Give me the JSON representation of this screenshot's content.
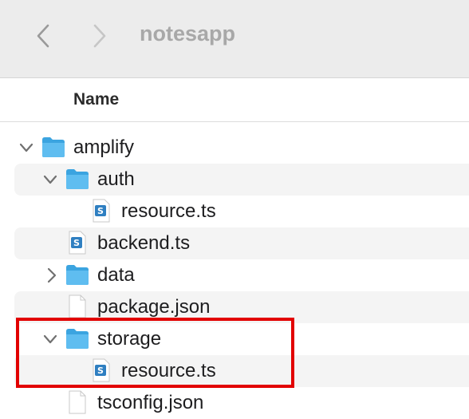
{
  "window": {
    "title": "notesapp"
  },
  "columns": {
    "name": "Name"
  },
  "rows": [
    {
      "label": "amplify",
      "kind": "folder",
      "expanded": true,
      "depth": 0
    },
    {
      "label": "auth",
      "kind": "folder",
      "expanded": true,
      "depth": 1
    },
    {
      "label": "resource.ts",
      "kind": "ts-file",
      "depth": 2
    },
    {
      "label": "backend.ts",
      "kind": "ts-file",
      "depth": 1
    },
    {
      "label": "data",
      "kind": "folder",
      "expanded": false,
      "depth": 1
    },
    {
      "label": "package.json",
      "kind": "file",
      "depth": 1
    },
    {
      "label": "storage",
      "kind": "folder",
      "expanded": true,
      "depth": 1
    },
    {
      "label": "resource.ts",
      "kind": "ts-file",
      "depth": 2
    },
    {
      "label": "tsconfig.json",
      "kind": "file",
      "depth": 1
    }
  ],
  "icons": {
    "back": "chevron-left-icon",
    "forward": "chevron-right-icon",
    "folder": "folder-icon",
    "ts_file": "typescript-file-icon",
    "file": "document-icon",
    "expanded": "chevron-down-icon",
    "collapsed": "chevron-right-icon"
  },
  "colors": {
    "folder": "#4fb5ec",
    "highlight": "#e20000",
    "ts_badge": "#2f7fc1"
  }
}
